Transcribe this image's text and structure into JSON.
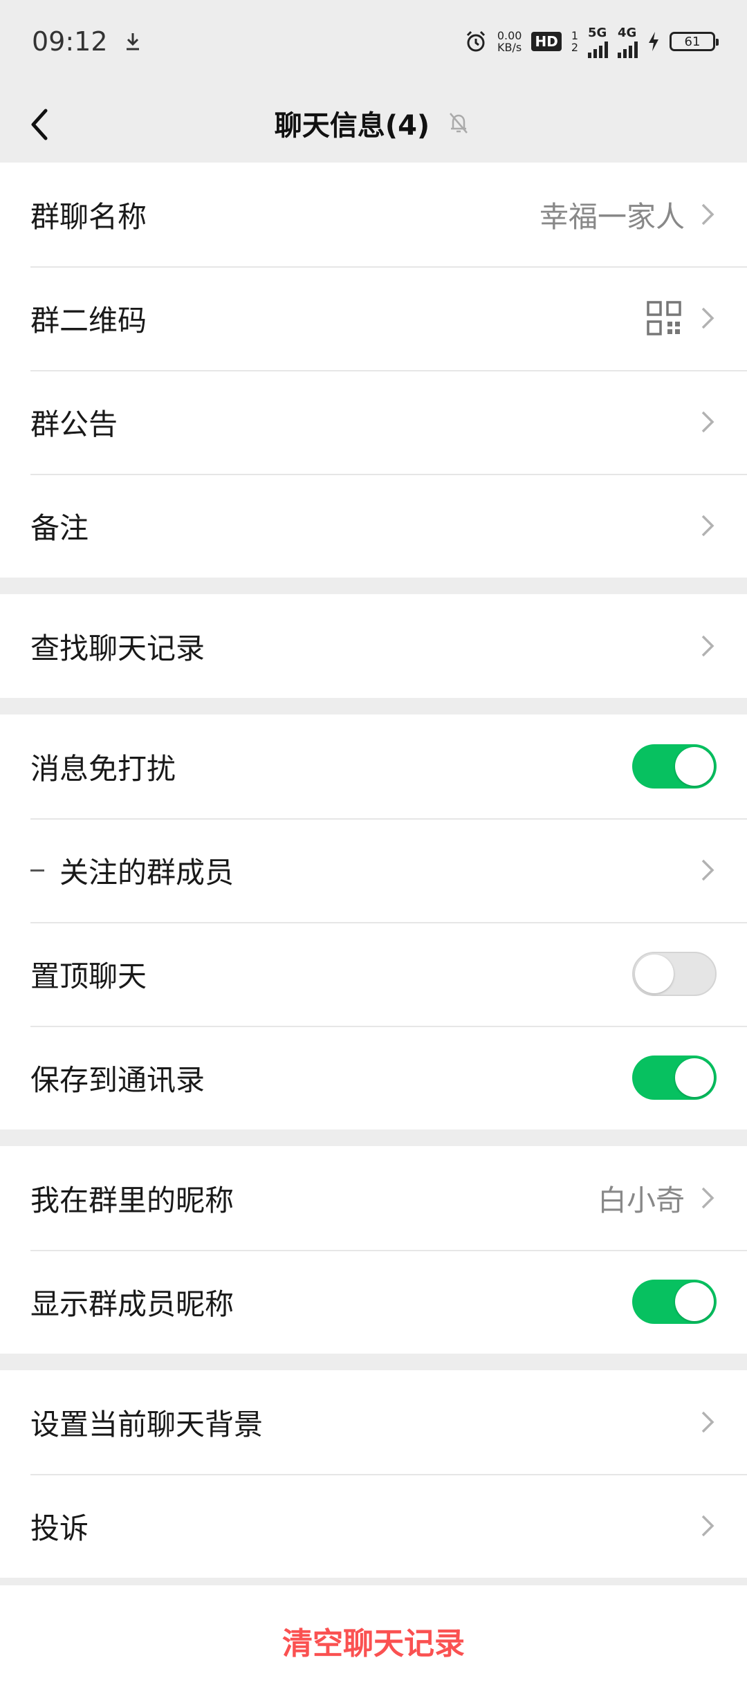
{
  "status_bar": {
    "time": "09:12",
    "net_speed_value": "0.00",
    "net_speed_unit": "KB/s",
    "hd_label": "HD",
    "hd_sub1": "1",
    "hd_sub2": "2",
    "net1_label": "5G",
    "net2_label": "4G",
    "battery_level": "61"
  },
  "nav": {
    "title": "聊天信息(4)"
  },
  "groups": {
    "info": {
      "group_name_label": "群聊名称",
      "group_name_value": "幸福一家人",
      "qr_label": "群二维码",
      "notice_label": "群公告",
      "remark_label": "备注"
    },
    "search": {
      "search_label": "查找聊天记录"
    },
    "settings": {
      "mute_label": "消息免打扰",
      "mute_on": true,
      "followed_label": "关注的群成员",
      "pin_label": "置顶聊天",
      "pin_on": false,
      "save_label": "保存到通讯录",
      "save_on": true
    },
    "nickname": {
      "my_nick_label": "我在群里的昵称",
      "my_nick_value": "白小奇",
      "show_nick_label": "显示群成员昵称",
      "show_nick_on": true
    },
    "other": {
      "background_label": "设置当前聊天背景",
      "complain_label": "投诉"
    }
  },
  "clear_history": "清空聊天记录",
  "colors": {
    "accent_green": "#07c160",
    "danger_red": "#fa5151",
    "background": "#ededed"
  }
}
